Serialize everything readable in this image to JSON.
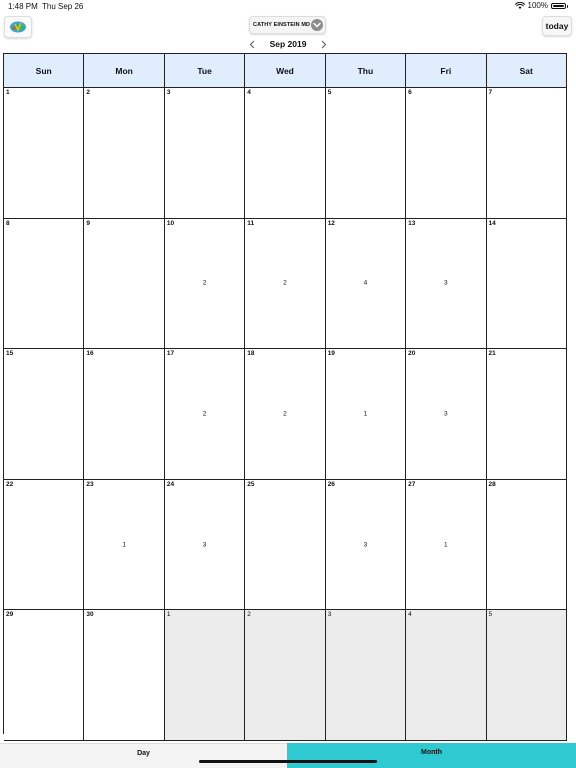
{
  "status_bar": {
    "time": "1:48 PM",
    "date": "Thu Sep 26",
    "battery": "100%",
    "battery_level": 1.0
  },
  "toolbar": {
    "provider": "CATHY EINSTEIN MD",
    "today_label": "today",
    "month_label": "Sep 2019"
  },
  "colors": {
    "weekday_header_bg": "#e0edfd",
    "other_month_bg": "#ececec",
    "active_segment": "#2fc9d1"
  },
  "calendar": {
    "weekdays": [
      "Sun",
      "Mon",
      "Tue",
      "Wed",
      "Thu",
      "Fri",
      "Sat"
    ],
    "weeks": [
      [
        {
          "day": "1",
          "count": ""
        },
        {
          "day": "2",
          "count": ""
        },
        {
          "day": "3",
          "count": ""
        },
        {
          "day": "4",
          "count": ""
        },
        {
          "day": "5",
          "count": ""
        },
        {
          "day": "6",
          "count": ""
        },
        {
          "day": "7",
          "count": ""
        }
      ],
      [
        {
          "day": "8",
          "count": ""
        },
        {
          "day": "9",
          "count": ""
        },
        {
          "day": "10",
          "count": "2"
        },
        {
          "day": "11",
          "count": "2"
        },
        {
          "day": "12",
          "count": "4"
        },
        {
          "day": "13",
          "count": "3"
        },
        {
          "day": "14",
          "count": ""
        }
      ],
      [
        {
          "day": "15",
          "count": ""
        },
        {
          "day": "16",
          "count": ""
        },
        {
          "day": "17",
          "count": "2"
        },
        {
          "day": "18",
          "count": "2"
        },
        {
          "day": "19",
          "count": "1"
        },
        {
          "day": "20",
          "count": "3"
        },
        {
          "day": "21",
          "count": ""
        }
      ],
      [
        {
          "day": "22",
          "count": ""
        },
        {
          "day": "23",
          "count": "1"
        },
        {
          "day": "24",
          "count": "3"
        },
        {
          "day": "25",
          "count": ""
        },
        {
          "day": "26",
          "count": "3"
        },
        {
          "day": "27",
          "count": "1"
        },
        {
          "day": "28",
          "count": ""
        }
      ],
      [
        {
          "day": "29",
          "count": ""
        },
        {
          "day": "30",
          "count": ""
        },
        {
          "day": "1",
          "count": "",
          "other": true
        },
        {
          "day": "2",
          "count": "",
          "other": true
        },
        {
          "day": "3",
          "count": "",
          "other": true
        },
        {
          "day": "4",
          "count": "",
          "other": true
        },
        {
          "day": "5",
          "count": "",
          "other": true
        }
      ]
    ]
  },
  "view_switcher": {
    "day_label": "Day",
    "month_label": "Month",
    "selected": "Month"
  },
  "icons": {
    "logo": "app-logo-icon",
    "provider_chevron": "chevron-down-icon",
    "prev": "chevron-left-icon",
    "next": "chevron-right-icon",
    "wifi": "wifi-icon",
    "battery": "battery-icon"
  }
}
